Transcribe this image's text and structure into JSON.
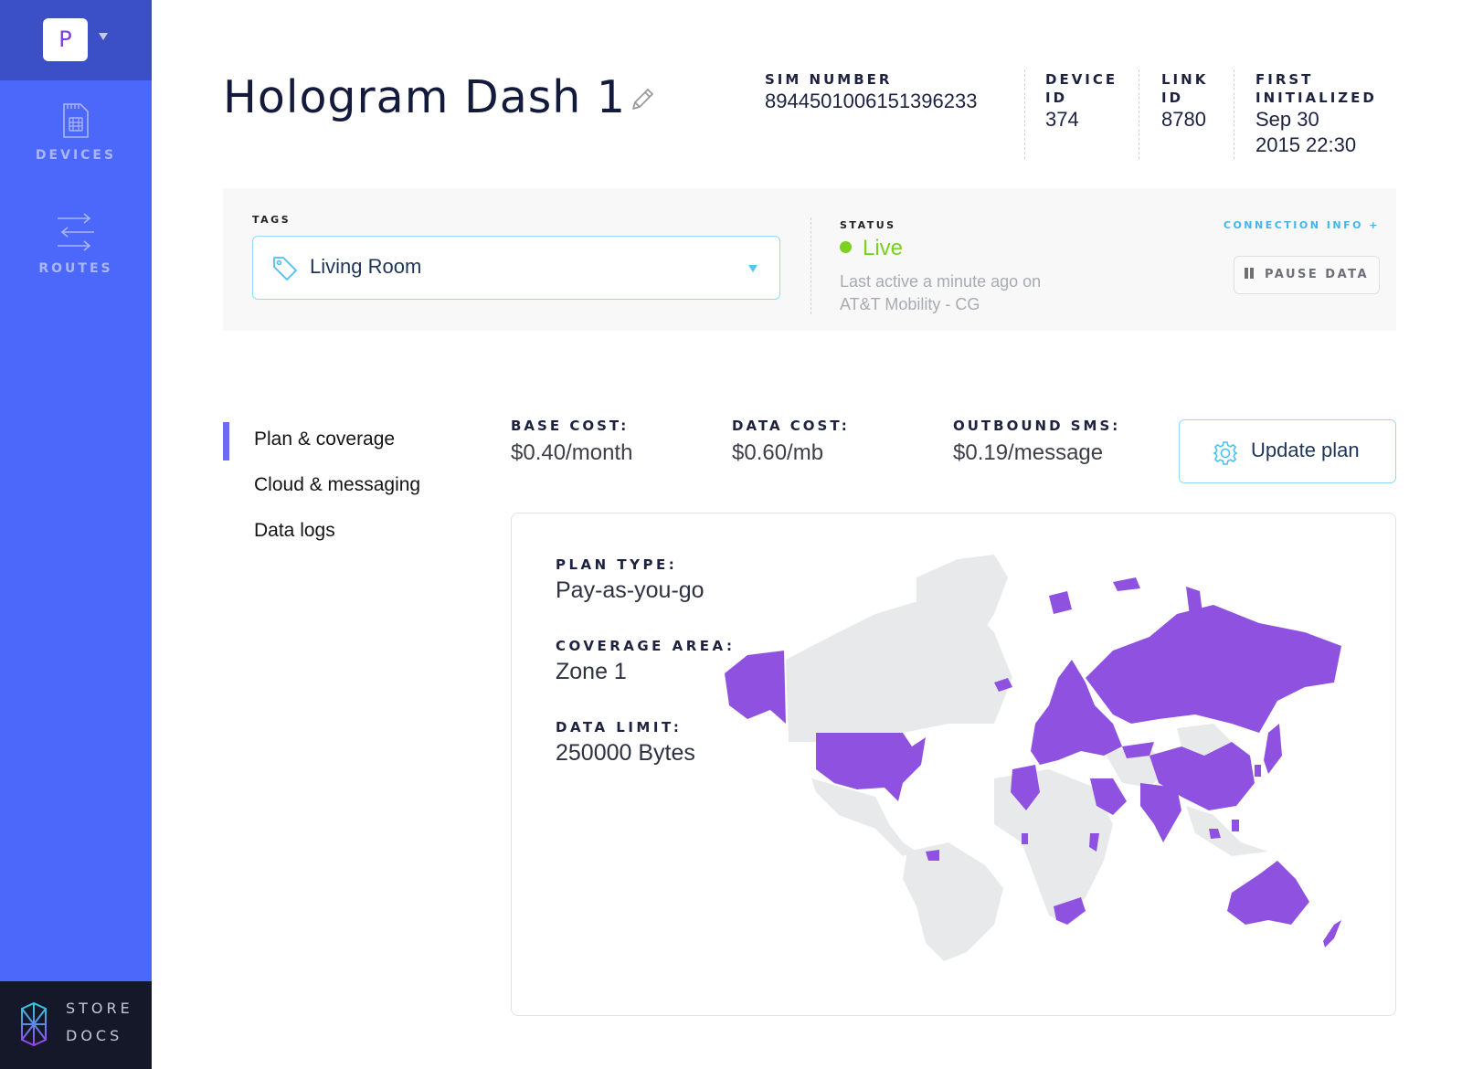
{
  "sidebar": {
    "org_initial": "P",
    "nav": [
      {
        "label": "DEVICES",
        "icon": "sim-card-icon"
      },
      {
        "label": "ROUTES",
        "icon": "routes-arrows-icon"
      }
    ],
    "bottom_links": [
      "STORE",
      "DOCS"
    ]
  },
  "header": {
    "device_name": "Hologram Dash 1",
    "meta": [
      {
        "label": "SIM NUMBER",
        "value": "89445010061513962​33"
      },
      {
        "label_lines": [
          "DEVICE",
          "ID"
        ],
        "value": "374"
      },
      {
        "label_lines": [
          "LINK",
          "ID"
        ],
        "value": "8780"
      },
      {
        "label_lines": [
          "FIRST",
          "INITIALIZED"
        ],
        "value_lines": [
          "Sep 30",
          "2015 22:30"
        ]
      }
    ]
  },
  "info_panel": {
    "tags_label": "TAGS",
    "tag_value": "Living Room",
    "status_label": "STATUS",
    "status_value": "Live",
    "status_color": "#7cd01f",
    "status_sub_lines": [
      "Last active a minute ago on",
      "AT&T Mobility - CG"
    ],
    "connection_info": "CONNECTION INFO +",
    "pause_label": "PAUSE DATA"
  },
  "tabs": [
    {
      "label": "Plan & coverage",
      "active": true
    },
    {
      "label": "Cloud & messaging",
      "active": false
    },
    {
      "label": "Data logs",
      "active": false
    }
  ],
  "pricing": [
    {
      "label": "BASE COST:",
      "value": "$0.40/month"
    },
    {
      "label": "DATA COST:",
      "value": "$0.60/mb"
    },
    {
      "label": "OUTBOUND SMS:",
      "value": "$0.19/message"
    }
  ],
  "update_plan_label": "Update plan",
  "plan": {
    "fields": [
      {
        "label": "PLAN TYPE:",
        "value": "Pay-as-you-go"
      },
      {
        "label": "COVERAGE AREA:",
        "value": "Zone 1"
      },
      {
        "label": "DATA LIMIT:",
        "value": "250000 Bytes"
      }
    ],
    "map": {
      "covered_color": "#8f52e0",
      "uncovered_color": "#e8e9ea",
      "covered_regions": [
        "Alaska",
        "United States",
        "Europe",
        "Iceland",
        "Svalbard",
        "Russia",
        "China",
        "India",
        "Saudi Arabia",
        "Algeria",
        "Turkey",
        "Kazakhstan",
        "Japan",
        "South Korea",
        "Australia",
        "New Zealand",
        "South Africa",
        "Kenya",
        "Ghana",
        "Guyana",
        "Malaysia",
        "Philippines",
        "Central America (partial)"
      ]
    }
  }
}
